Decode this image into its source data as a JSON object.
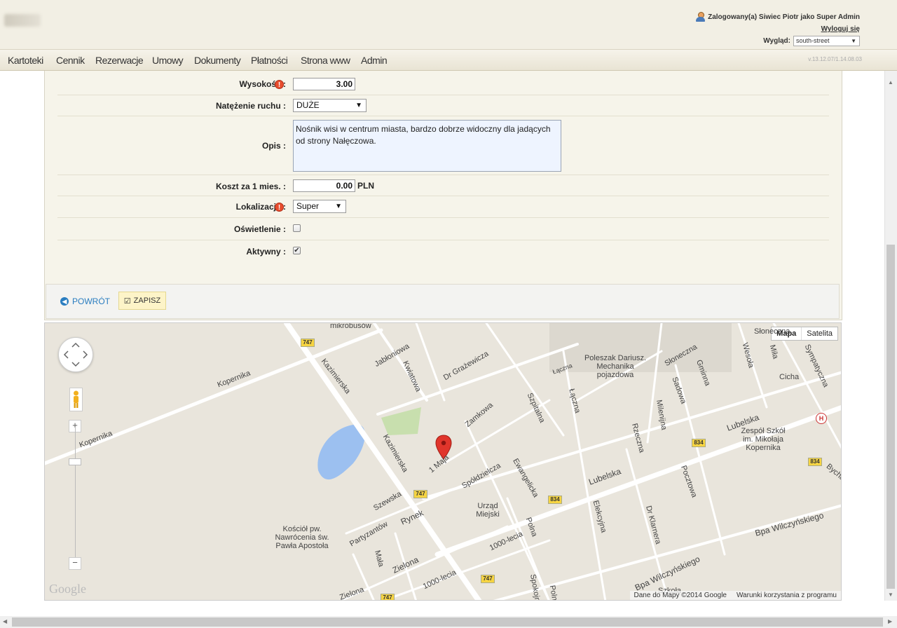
{
  "header": {
    "user_text": "Zalogowany(a) Siwiec Piotr jako Super Admin",
    "logout_label": "Wyloguj się",
    "look_label": "Wygląd:",
    "look_value": "south-street",
    "version": "v.13.12.07/1.14.08.03"
  },
  "nav": {
    "items": [
      "Kartoteki",
      "Cennik",
      "Rezerwacje",
      "Umowy",
      "Dokumenty",
      "Płatności",
      "Strona www",
      "Admin"
    ]
  },
  "form": {
    "height_label": "Wysokość :",
    "height_value": "3.00",
    "traffic_label": "Natężenie ruchu :",
    "traffic_value": "DUŻE",
    "desc_label": "Opis :",
    "desc_value": "Nośnik wisi w centrum miasta, bardzo dobrze widoczny dla jadących od strony Nałęczowa.",
    "cost_label": "Koszt za 1 mies. :",
    "cost_value": "0.00",
    "cost_unit": "PLN",
    "location_label": "Lokalizacja :",
    "location_value": "Super",
    "lighting_label": "Oświetlenie :",
    "lighting_checked": false,
    "active_label": "Aktywny :",
    "active_checked": true,
    "back_label": "POWRÓT",
    "save_label": "ZAPISZ"
  },
  "map": {
    "type_map": "Mapa",
    "type_satellite": "Satelita",
    "attribution": "Dane do Mapy ©2014 Google",
    "terms": "Warunki korzystania z programu",
    "logo": "Google",
    "labels": [
      "mikrobusów",
      "Kopernika",
      "Kopernika",
      "Kazimierska",
      "Kazimierska",
      "Jabłoniowa",
      "Kwiatowa",
      "Dr Grażewicza",
      "Zamkowa",
      "Szpitalna",
      "Łączna",
      "Łączna",
      "Poleszak Dariusz. Mechanika pojazdowa",
      "Słoneczna",
      "Gminna",
      "Wesoła",
      "Miła",
      "Sympatyczna",
      "Cicha",
      "Sadowa",
      "Milenijna",
      "Rzeczna",
      "Lubelska",
      "Lubelska",
      "Zespół Szkół im. Mikołaja Kopernika",
      "Bychawska",
      "1 Maja",
      "Spółdzielcza",
      "Ewangelicka",
      "Urząd Miejski",
      "Elekcyjna",
      "Pocztowa",
      "Dr Klarnera",
      "Bpa Wilczyńskiego",
      "Bpa Wilczyńskiego",
      "Szewska",
      "Rynek",
      "Partyzantów",
      "Kościół pw. Nawrócenia św. Pawła Apostoła",
      "Polna",
      "1000-lecia",
      "1000-lecia",
      "Zielona",
      "Zielona",
      "Mała",
      "Szkoła",
      "Spokojna",
      "Polna",
      "Słoneczna"
    ],
    "road_numbers": [
      "747",
      "747",
      "747",
      "747",
      "834",
      "834",
      "834"
    ]
  },
  "colors": {
    "panel_bg": "#f6f4ea",
    "accent_blue": "#2a7dc0",
    "warn_red": "#e84d2e",
    "save_bg": "#fdf4c8",
    "map_bg": "#e9e5dc",
    "road_shield": "#f6d442"
  },
  "icons": [
    "user-icon",
    "warning-icon",
    "back-arrow-icon",
    "check-icon",
    "map-marker-icon",
    "pegman-icon",
    "pan-control-icon",
    "hospital-icon",
    "school-icon"
  ]
}
